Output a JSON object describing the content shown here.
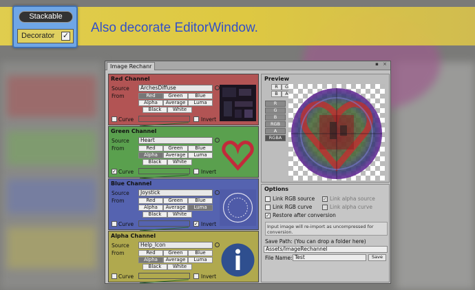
{
  "badge": {
    "stackable": "Stackable",
    "decorator": "Decorator",
    "check": "✓"
  },
  "banner": {
    "text": "Also decorate EditorWindow."
  },
  "window": {
    "tab": "Image Rechanr",
    "controls": "▪ ×",
    "channels": [
      {
        "title": "Red Channel",
        "source_label": "Source",
        "source_value": "ArchesDiffuse",
        "from_label": "From",
        "buttons": [
          "Red",
          "Green",
          "Blue",
          "Alpha",
          "Average",
          "Luma",
          "Black",
          "White"
        ],
        "selected": "Red",
        "curve_label": "Curve",
        "curve_checked": false,
        "invert_label": "Invert",
        "invert_checked": false,
        "color": "#b25454"
      },
      {
        "title": "Green Channel",
        "source_label": "Source",
        "source_value": "Heart",
        "from_label": "From",
        "buttons": [
          "Red",
          "Green",
          "Blue",
          "Alpha",
          "Average",
          "Luma",
          "Black",
          "White"
        ],
        "selected": "Alpha",
        "curve_label": "Curve",
        "curve_checked": true,
        "invert_label": "Invert",
        "invert_checked": false,
        "color": "#5aa04e"
      },
      {
        "title": "Blue Channel",
        "source_label": "Source",
        "source_value": "Joystick",
        "from_label": "From",
        "buttons": [
          "Red",
          "Green",
          "Blue",
          "Alpha",
          "Average",
          "Luma",
          "Black",
          "White"
        ],
        "selected": "Luma",
        "curve_label": "Curve",
        "curve_checked": false,
        "invert_label": "Invert",
        "invert_checked": true,
        "color": "#5563b0"
      },
      {
        "title": "Alpha Channel",
        "source_label": "Source",
        "source_value": "Help_Icon",
        "from_label": "From",
        "buttons": [
          "Red",
          "Green",
          "Blue",
          "Alpha",
          "Average",
          "Luma",
          "Black",
          "White"
        ],
        "selected": "Alpha",
        "curve_label": "Curve",
        "curve_checked": false,
        "invert_label": "Invert",
        "invert_checked": false,
        "color": "#b0a94e"
      }
    ],
    "preview": {
      "title": "Preview",
      "mini_buttons": [
        "R",
        "G",
        "B",
        "A"
      ],
      "modes": [
        "R",
        "G",
        "B",
        "RGB",
        "A",
        "RGBA"
      ],
      "active_mode": "RGBA"
    },
    "options": {
      "title": "Options",
      "link_rgb_source": "Link RGB source",
      "link_alpha_source": "Link alpha source",
      "link_rgb_curve": "Link RGB curve",
      "link_alpha_curve": "Link alpha curve",
      "restore": "Restore after conversion",
      "note": "Input image will re-import as uncompressed for conversion.",
      "save_path_label": "Save Path: (You can drop a folder here)",
      "save_path_value": "Assets/ImageRechannel",
      "file_name_label": "File Name:",
      "file_name_value": "Test",
      "save_button": "Save"
    }
  }
}
